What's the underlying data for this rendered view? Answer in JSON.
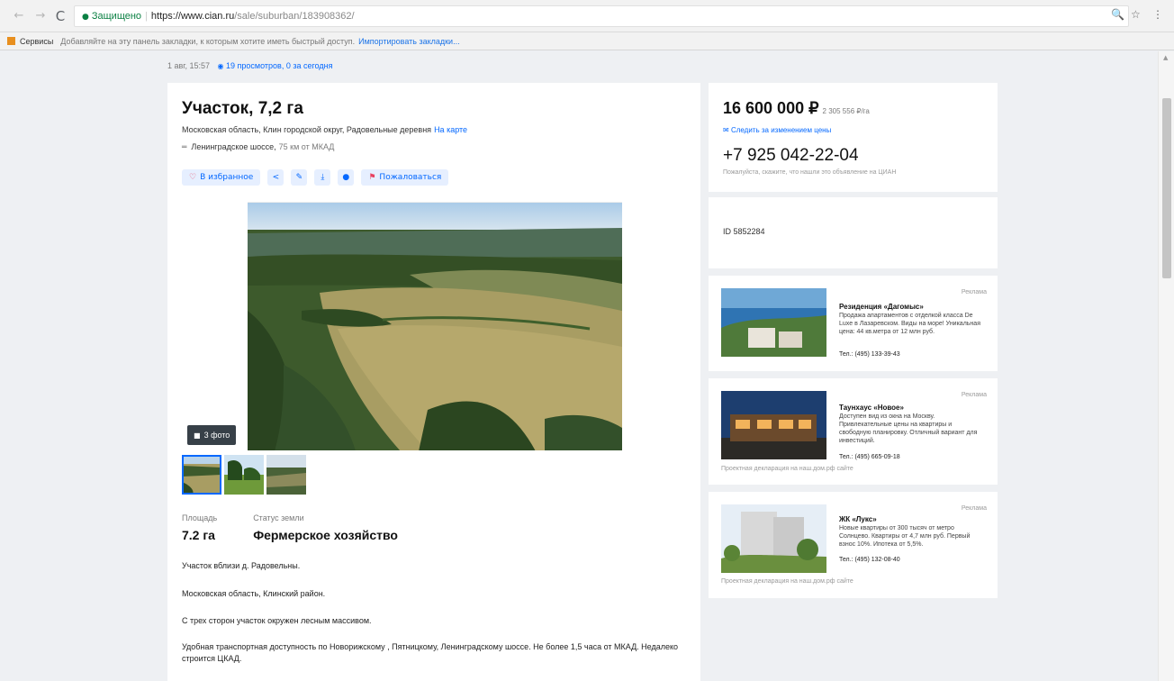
{
  "browser": {
    "nav_back": "←",
    "nav_forward": "→",
    "reload": "C",
    "secure_label": "Защищено",
    "url_host": "https://www.cian.ru",
    "url_path": "/sale/suburban/183908362/",
    "zoom_icon": "🔍",
    "star_icon": "☆",
    "menu_icon": "⋮",
    "bookmarks_apps": "Сервисы",
    "bookmarks_hint": "Добавляйте на эту панель закладки, к которым хотите иметь быстрый доступ.",
    "bookmarks_import": "Импортировать закладки..."
  },
  "listing": {
    "published": "1 авг, 15:57",
    "views": "19 просмотров, 0 за сегодня",
    "title": "Участок, 7,2 га",
    "address": "Московская область, Клин городской округ, Радовельные деревня",
    "map_link": "На карте",
    "highway": "Ленинградское шоссе,",
    "highway_distance": "75 км от МКАД",
    "actions": {
      "favorite": "В избранное",
      "share_icon": "<",
      "edit_icon": "✎",
      "download_icon": "⤓",
      "more_icon": "●",
      "complain": "Пожаловаться"
    },
    "photo_count": "3 фото",
    "specs": [
      {
        "label": "Площадь",
        "value": "7.2 га"
      },
      {
        "label": "Статус земли",
        "value": "Фермерское хозяйство"
      }
    ],
    "description": [
      "Участок вблизи д. Радовельны.",
      "Московская область, Клинский район.",
      "С трех сторон участок окружен лесным массивом.",
      "Удобная транспортная доступность по Новорижскому , Пятницкому, Ленинградскому шоссе. Не более 1,5 часа от МКАД. Недалеко строится ЦКАД."
    ]
  },
  "sidebar": {
    "price": "16 600 000 ₽",
    "price_per": "2 305 556 ₽/га",
    "follow_price": "Следить за изменением цены",
    "phone": "+7 925 042-22-04",
    "phone_note": "Пожалуйста, скажите, что нашли это объявление на ЦИАН",
    "listing_id": "ID 5852284",
    "ads": [
      {
        "tag": "Реклама",
        "title": "Резиденция «Дагомыс»",
        "body": "Продажа апартаментов с отделкой класса De Luxe в Лазаревском. Виды на море! Уникальная цена: 44 кв.метра от 12 млн руб.",
        "phone": "Тел.: (495) 133-39-43",
        "footer": ""
      },
      {
        "tag": "Реклама",
        "title": "Таунхаус «Новое»",
        "body": "Доступен вид из окна на Москву. Привлекательные цены на квартиры и свободную планировку. Отличный вариант для инвестиций.",
        "phone": "Тел.: (495) 665-09-18",
        "footer": "Проектная декларация на наш.дом.рф сайте"
      },
      {
        "tag": "Реклама",
        "title": "ЖК «Лукс»",
        "body": "Новые квартиры от 300 тысяч от метро Солнцево. Квартиры от 4,7 млн руб. Первый взнос 10%. Ипотека от 5,5%.",
        "phone": "Тел.: (495) 132-08-40",
        "footer": "Проектная декларация на наш.дом.рф сайте"
      }
    ]
  },
  "colors": {
    "accent": "#0468ff",
    "complain": "#e84260",
    "page_bg": "#eef0f3"
  }
}
